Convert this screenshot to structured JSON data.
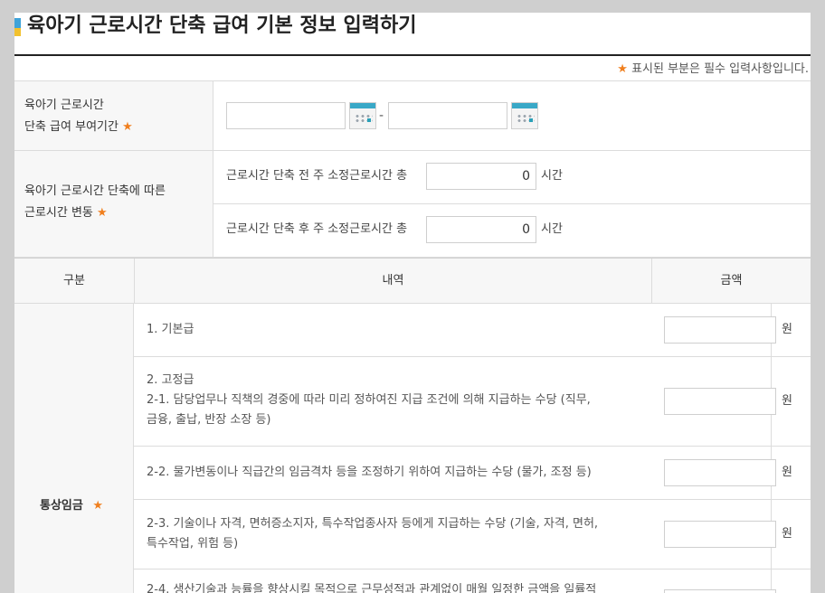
{
  "page": {
    "title": "육아기 근로시간 단축 급여 기본 정보 입력하기",
    "required_note_star": "★",
    "required_note": "표시된 부분은 필수 입력사항입니다."
  },
  "period": {
    "label_line1": "육아기 근로시간",
    "label_line2": "단축 급여 부여기간",
    "star": "★",
    "start_value": "",
    "end_value": "",
    "separator": "-"
  },
  "hours": {
    "label_line1": "육아기 근로시간 단축에 따른",
    "label_line2": "근로시간 변동",
    "star": "★",
    "before_label": "근로시간 단축 전 주 소정근로시간 총",
    "before_value": "0",
    "after_label": "근로시간 단축 후 주 소정근로시간 총",
    "after_value": "0",
    "unit": "시간"
  },
  "wage_table": {
    "headers": {
      "category": "구분",
      "detail": "내역",
      "amount": "금액"
    },
    "category_label": "통상임금",
    "category_star": "★",
    "currency": "원",
    "items": [
      {
        "line1": "1. 기본급",
        "line2": "",
        "line3": "",
        "amount": ""
      },
      {
        "line1": "2. 고정급",
        "line2": "2-1. 담당업무나 직책의 경중에 따라 미리 정하여진 지급 조건에 의해 지급하는 수당 (직무,",
        "line3": "금융, 출납, 반장 소장 등)",
        "amount": ""
      },
      {
        "line1": "2-2. 물가변동이나 직급간의 임금격차 등을 조정하기 위하여 지급하는 수당 (물가, 조정 등)",
        "line2": "",
        "line3": "",
        "amount": ""
      },
      {
        "line1": "2-3. 기술이나 자격, 면허증소지자, 특수작업종사자 등에게 지급하는 수당 (기술, 자격, 면허,",
        "line2": "특수작업, 위험 등)",
        "line3": "",
        "amount": ""
      },
      {
        "line1": "2-4. 생산기술과 능률을 향상시킬 목적으로 근무성적과 관계없이 매월 일정한 금액을 일률적",
        "line2": "",
        "line3": "",
        "amount": ""
      }
    ]
  },
  "icons": {
    "calendar": "calendar-icon"
  },
  "colors": {
    "accent_star": "#f07f1e",
    "calendar_bar": "#39a8c7",
    "title_mark_blue": "#3fa3d9",
    "title_mark_yellow": "#f2c12e"
  }
}
